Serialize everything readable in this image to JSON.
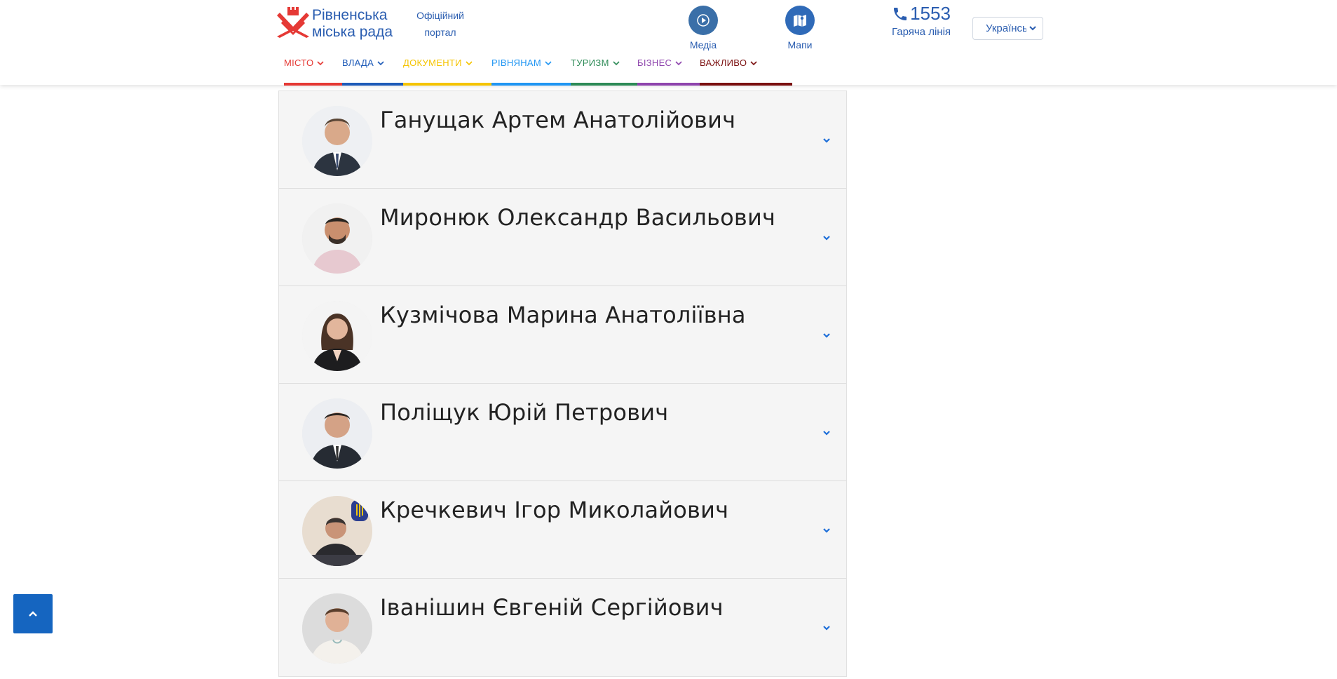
{
  "header": {
    "logo_line1": "Рівненська",
    "logo_line2": "міська рада",
    "portal_line1": "Офіційний",
    "portal_line2": "портал",
    "media_label": "Медіа",
    "maps_label": "Мапи",
    "hotline_number": "1553",
    "hotline_label": "Гаряча лінія",
    "language_selected": "Українська"
  },
  "nav": {
    "items": [
      {
        "label": "МІСТО",
        "color": "#e53935"
      },
      {
        "label": "ВЛАДА",
        "color": "#1e5bb8"
      },
      {
        "label": "ДОКУМЕНТИ",
        "color": "#f5c400"
      },
      {
        "label": "РІВНЯНАМ",
        "color": "#2196f3"
      },
      {
        "label": "ТУРИЗМ",
        "color": "#2e8b57"
      },
      {
        "label": "БІЗНЕС",
        "color": "#8e44ad"
      },
      {
        "label": "ВАЖЛИВО",
        "color": "#7b1010"
      }
    ]
  },
  "people": [
    {
      "name": "Ганущак Артем Анатолійович"
    },
    {
      "name": "Миронюк Олександр Васильович"
    },
    {
      "name": "Кузмічова Марина Анатоліївна"
    },
    {
      "name": "Поліщук Юрій Петрович"
    },
    {
      "name": "Кречкевич Ігор Миколайович"
    },
    {
      "name": "Іванішин Євгеній Сергійович"
    }
  ],
  "colors": {
    "brand_blue": "#2a5db0",
    "accent_red": "#e53935",
    "scroll_top_button": "#1565c0"
  },
  "icons": {
    "expand": "chevron-down-icon",
    "scroll_top": "chevron-up-icon",
    "phone": "phone-icon",
    "media": "play-icon",
    "maps": "map-icon"
  }
}
